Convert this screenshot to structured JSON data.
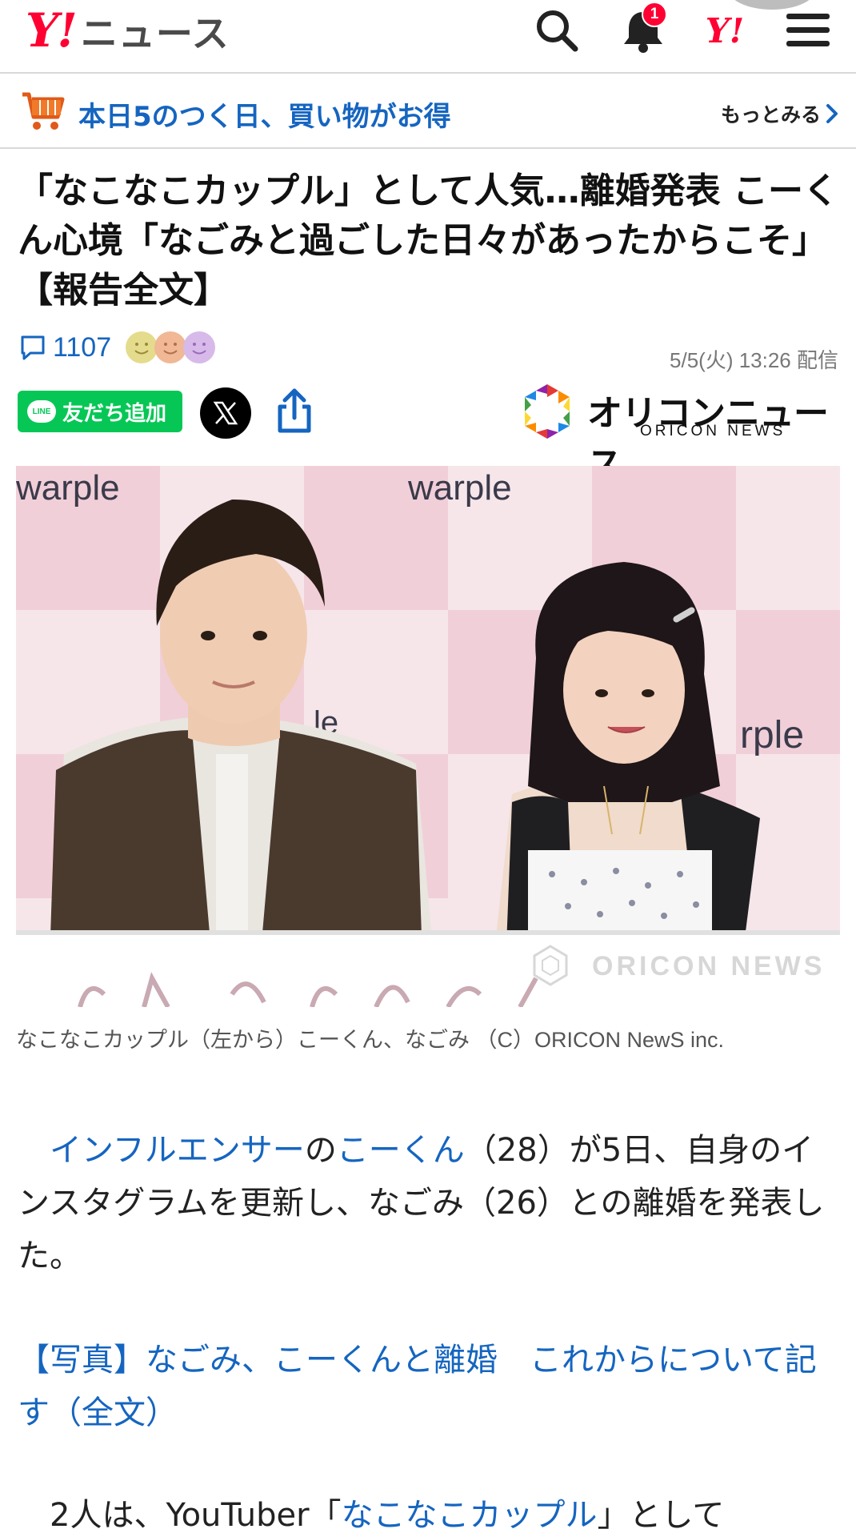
{
  "header": {
    "logo_y": "Y!",
    "logo_text": "ニュース",
    "notification_count": "1",
    "yid_logo": "Y!",
    "icons": [
      "search-icon",
      "bell-icon",
      "yahoo-id-icon",
      "menu-icon"
    ]
  },
  "promo": {
    "text": "本日5のつく日、買い物がお得",
    "more_label": "もっとみる",
    "icon": "shopping-cart-icon"
  },
  "article": {
    "title": "「なこなこカップル」として人気…離婚発表 こーくん心境「なごみと過ごした日々があったからこそ」【報告全文】",
    "comment_count": "1107",
    "date": "5/5(火) 13:26 配信",
    "line_badge": "LINE",
    "line_button": "友だち追加",
    "source_logo_main": "オリコンニュース",
    "source_logo_sub": "ORICON NEWS",
    "photo": {
      "backdrop_text_1": "warple",
      "backdrop_text_2": "warple",
      "backdrop_text_3": "rple",
      "backdrop_text_4": "le",
      "watermark": "ORICON NEWS"
    },
    "caption": "なこなこカップル（左から）こーくん、なごみ （C）ORICON NewS inc.",
    "para1": {
      "link1": "インフルエンサー",
      "text1": "の",
      "link2": "こーくん",
      "text2": "（28）が5日、自身のインスタグラムを更新し、なごみ（26）との離婚を発表した。"
    },
    "para2_link": "【写真】なごみ、こーくんと離婚　これからについて記す（全文）",
    "para3": {
      "text1": "2人は、YouTuber「",
      "link": "なこなこカップル",
      "text2": "」として"
    }
  },
  "colors": {
    "brand_red": "#ff0033",
    "link_blue": "#1565c0",
    "line_green": "#06c755"
  }
}
